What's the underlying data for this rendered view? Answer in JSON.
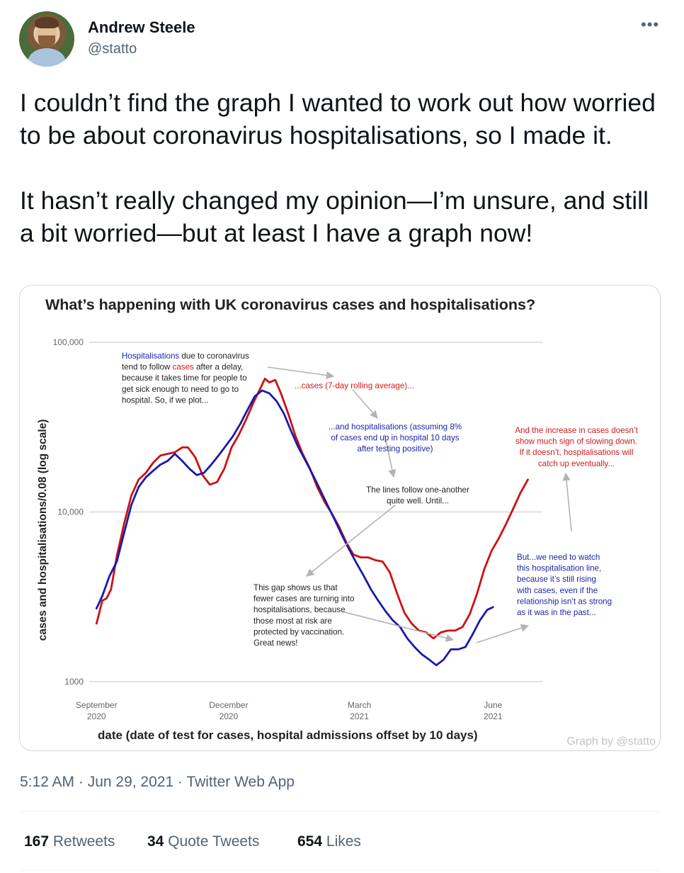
{
  "tweet": {
    "author_name": "Andrew Steele",
    "author_handle": "@statto",
    "text": "I couldn’t find the graph I wanted to work out how worried to be about coronavirus hospitalisations, so I made it.\n\nIt hasn’t really changed my opinion—I’m unsure, and still a bit worried—but at least I have a graph now!",
    "timestamp": "5:12 AM · Jun 29, 2021 · Twitter Web App",
    "stats": {
      "retweets_count": "167",
      "retweets_label": "Retweets",
      "quotes_count": "34",
      "quotes_label": "Quote Tweets",
      "likes_count": "654",
      "likes_label": "Likes"
    },
    "more_icon": "more-horizontal-icon"
  },
  "chart_data": {
    "type": "line",
    "title": "What’s happening with UK coronavirus cases and hospitalisations?",
    "xlabel": "date (date of test for cases, hospital admissions offset by 10 days)",
    "ylabel": "cases and hospitalisations/0.08 (log scale)",
    "yscale": "log",
    "ylim": [
      1000,
      100000
    ],
    "yticks": [
      "1000",
      "10,000",
      "100,000"
    ],
    "xtick_labels": [
      {
        "label": "September",
        "year": "2020",
        "date": "2020-09-01"
      },
      {
        "label": "December",
        "year": "2020",
        "date": "2020-12-01"
      },
      {
        "label": "March",
        "year": "2021",
        "date": "2021-03-01"
      },
      {
        "label": "June",
        "year": "2021",
        "date": "2021-06-01"
      }
    ],
    "xlim": [
      "2020-08-27",
      "2021-07-05"
    ],
    "grid": "horizontal",
    "credit": "Graph by @statto",
    "series": [
      {
        "name": "cases",
        "color": "#cc1111",
        "points": [
          [
            "2020-09-01",
            2200
          ],
          [
            "2020-09-05",
            3000
          ],
          [
            "2020-09-08",
            3100
          ],
          [
            "2020-09-11",
            3500
          ],
          [
            "2020-09-15",
            5500
          ],
          [
            "2020-09-20",
            8500
          ],
          [
            "2020-09-25",
            12500
          ],
          [
            "2020-09-30",
            15500
          ],
          [
            "2020-10-05",
            17000
          ],
          [
            "2020-10-10",
            19500
          ],
          [
            "2020-10-15",
            21500
          ],
          [
            "2020-10-20",
            22000
          ],
          [
            "2020-10-25",
            22500
          ],
          [
            "2020-10-30",
            24000
          ],
          [
            "2020-11-03",
            24000
          ],
          [
            "2020-11-08",
            21000
          ],
          [
            "2020-11-13",
            16500
          ],
          [
            "2020-11-18",
            14500
          ],
          [
            "2020-11-23",
            15000
          ],
          [
            "2020-11-28",
            18000
          ],
          [
            "2020-12-03",
            24000
          ],
          [
            "2020-12-08",
            28500
          ],
          [
            "2020-12-13",
            35000
          ],
          [
            "2020-12-18",
            44000
          ],
          [
            "2020-12-23",
            54000
          ],
          [
            "2020-12-26",
            61000
          ],
          [
            "2020-12-29",
            58000
          ],
          [
            "2021-01-02",
            60000
          ],
          [
            "2021-01-06",
            50000
          ],
          [
            "2021-01-11",
            38000
          ],
          [
            "2021-01-16",
            28000
          ],
          [
            "2021-01-21",
            22000
          ],
          [
            "2021-01-26",
            18000
          ],
          [
            "2021-01-31",
            14000
          ],
          [
            "2021-02-05",
            11500
          ],
          [
            "2021-02-10",
            9800
          ],
          [
            "2021-02-15",
            8200
          ],
          [
            "2021-02-20",
            6600
          ],
          [
            "2021-02-25",
            5600
          ],
          [
            "2021-03-02",
            5400
          ],
          [
            "2021-03-07",
            5400
          ],
          [
            "2021-03-12",
            5200
          ],
          [
            "2021-03-17",
            5100
          ],
          [
            "2021-03-22",
            4400
          ],
          [
            "2021-03-27",
            3300
          ],
          [
            "2021-04-01",
            2550
          ],
          [
            "2021-04-06",
            2200
          ],
          [
            "2021-04-11",
            2000
          ],
          [
            "2021-04-16",
            1950
          ],
          [
            "2021-04-21",
            1800
          ],
          [
            "2021-04-26",
            1950
          ],
          [
            "2021-05-01",
            2000
          ],
          [
            "2021-05-06",
            2000
          ],
          [
            "2021-05-11",
            2100
          ],
          [
            "2021-05-16",
            2500
          ],
          [
            "2021-05-21",
            3300
          ],
          [
            "2021-05-26",
            4600
          ],
          [
            "2021-05-31",
            5900
          ],
          [
            "2021-06-05",
            7000
          ],
          [
            "2021-06-10",
            8500
          ],
          [
            "2021-06-15",
            10500
          ],
          [
            "2021-06-20",
            13000
          ],
          [
            "2021-06-25",
            15500
          ]
        ]
      },
      {
        "name": "hospitalisations",
        "color": "#1a1aaa",
        "points": [
          [
            "2020-09-01",
            2700
          ],
          [
            "2020-09-05",
            3200
          ],
          [
            "2020-09-10",
            4200
          ],
          [
            "2020-09-15",
            5100
          ],
          [
            "2020-09-20",
            7500
          ],
          [
            "2020-09-25",
            11000
          ],
          [
            "2020-09-30",
            14000
          ],
          [
            "2020-10-05",
            16000
          ],
          [
            "2020-10-10",
            17500
          ],
          [
            "2020-10-15",
            19000
          ],
          [
            "2020-10-20",
            20000
          ],
          [
            "2020-10-25",
            22000
          ],
          [
            "2020-10-30",
            20000
          ],
          [
            "2020-11-04",
            18000
          ],
          [
            "2020-11-09",
            16500
          ],
          [
            "2020-11-14",
            17000
          ],
          [
            "2020-11-19",
            19000
          ],
          [
            "2020-11-24",
            21500
          ],
          [
            "2020-11-29",
            24500
          ],
          [
            "2020-12-04",
            28000
          ],
          [
            "2020-12-09",
            33000
          ],
          [
            "2020-12-14",
            40000
          ],
          [
            "2020-12-19",
            48000
          ],
          [
            "2020-12-24",
            52000
          ],
          [
            "2020-12-29",
            50000
          ],
          [
            "2021-01-03",
            45000
          ],
          [
            "2021-01-08",
            38000
          ],
          [
            "2021-01-13",
            30000
          ],
          [
            "2021-01-18",
            24000
          ],
          [
            "2021-01-23",
            20000
          ],
          [
            "2021-01-28",
            16500
          ],
          [
            "2021-02-02",
            13500
          ],
          [
            "2021-02-07",
            11000
          ],
          [
            "2021-02-12",
            9000
          ],
          [
            "2021-02-17",
            7300
          ],
          [
            "2021-02-22",
            6000
          ],
          [
            "2021-02-27",
            5000
          ],
          [
            "2021-03-04",
            4200
          ],
          [
            "2021-03-09",
            3500
          ],
          [
            "2021-03-14",
            3000
          ],
          [
            "2021-03-19",
            2600
          ],
          [
            "2021-03-24",
            2300
          ],
          [
            "2021-03-29",
            2100
          ],
          [
            "2021-04-03",
            1800
          ],
          [
            "2021-04-08",
            1600
          ],
          [
            "2021-04-13",
            1450
          ],
          [
            "2021-04-18",
            1350
          ],
          [
            "2021-04-23",
            1250
          ],
          [
            "2021-04-28",
            1350
          ],
          [
            "2021-05-03",
            1550
          ],
          [
            "2021-05-08",
            1550
          ],
          [
            "2021-05-13",
            1600
          ],
          [
            "2021-05-18",
            1900
          ],
          [
            "2021-05-23",
            2300
          ],
          [
            "2021-05-28",
            2650
          ],
          [
            "2021-06-01",
            2750
          ]
        ]
      }
    ],
    "annotations": [
      {
        "id": "ann-intro",
        "lines": [
          [
            [
              "Hospitalisations",
              "blue"
            ],
            [
              " due to coronavirus",
              "black"
            ]
          ],
          [
            [
              "tend to follow ",
              "black"
            ],
            [
              "cases",
              "red"
            ],
            [
              " after a delay,",
              "black"
            ]
          ],
          [
            [
              "because it takes time for people to",
              "black"
            ]
          ],
          [
            [
              "get sick enough to need to go to",
              "black"
            ]
          ],
          [
            [
              "hospital. So, if we plot...",
              "black"
            ]
          ]
        ]
      },
      {
        "id": "ann-cases",
        "lines": [
          [
            [
              "...cases (7-day rolling average)...",
              "red"
            ]
          ]
        ]
      },
      {
        "id": "ann-hosp",
        "lines": [
          [
            [
              "...and hospitalisations (assuming 8%",
              "blue"
            ]
          ],
          [
            [
              "of cases end up in hospital 10 days",
              "blue"
            ]
          ],
          [
            [
              "after testing positive)",
              "blue"
            ]
          ]
        ]
      },
      {
        "id": "ann-follow",
        "lines": [
          [
            [
              "The lines follow one-another",
              "black"
            ]
          ],
          [
            [
              "quite well. Until...",
              "black"
            ]
          ]
        ]
      },
      {
        "id": "ann-gap",
        "lines": [
          [
            [
              "This gap shows us that",
              "black"
            ]
          ],
          [
            [
              "fewer cases are turning into",
              "black"
            ]
          ],
          [
            [
              "hospitalisations, because",
              "black"
            ]
          ],
          [
            [
              "those most at risk are",
              "black"
            ]
          ],
          [
            [
              "protected by vaccination.",
              "black"
            ]
          ],
          [
            [
              "Great news!",
              "black"
            ]
          ]
        ]
      },
      {
        "id": "ann-increase",
        "lines": [
          [
            [
              "And the increase in cases doesn’t",
              "red"
            ]
          ],
          [
            [
              "show much sign of slowing down.",
              "red"
            ]
          ],
          [
            [
              "If it doesn’t, hospitalisations will",
              "red"
            ]
          ],
          [
            [
              "catch up eventually...",
              "red"
            ]
          ]
        ]
      },
      {
        "id": "ann-watch",
        "lines": [
          [
            [
              "But...we need to watch",
              "blue"
            ]
          ],
          [
            [
              "this hospitalisation line,",
              "blue"
            ]
          ],
          [
            [
              "because it’s still rising",
              "blue"
            ]
          ],
          [
            [
              "with cases, even if the",
              "blue"
            ]
          ],
          [
            [
              "relationship isn’t as strong",
              "blue"
            ]
          ],
          [
            [
              "as it was in the past...",
              "blue"
            ]
          ]
        ]
      }
    ]
  }
}
